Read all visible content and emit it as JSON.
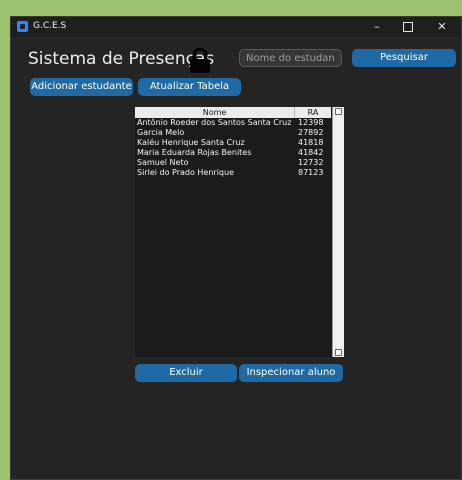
{
  "window": {
    "app_title": "G.C.E.S"
  },
  "icons": {
    "app": "app-logo-icon",
    "minimize": "minimize-icon",
    "maximize": "maximize-icon",
    "close": "close-icon",
    "lock": "lock-icon"
  },
  "header": {
    "title": "Sistema de Presenças",
    "search_placeholder": "Nome do estudante",
    "search_button": "Pesquisar"
  },
  "toolbar": {
    "add_student": "Adicionar estudante",
    "refresh_table": "Atualizar Tabela"
  },
  "table": {
    "columns": [
      "Nome",
      "RA"
    ],
    "rows": [
      {
        "name": "Antônio Roeder dos Santos Santa Cruz",
        "ra": "12398"
      },
      {
        "name": "Garcia Melo",
        "ra": "27892"
      },
      {
        "name": "Kaléu Henrique Santa Cruz",
        "ra": "41818"
      },
      {
        "name": "Maria Eduarda Rojas Benites",
        "ra": "41842"
      },
      {
        "name": "Samuel Neto",
        "ra": "12732"
      },
      {
        "name": "Sirlei do Prado Henrique",
        "ra": "87123"
      }
    ]
  },
  "actions": {
    "delete": "Excluir",
    "inspect": "Inspecionar aluno"
  },
  "colors": {
    "accent": "#1f6aa5",
    "background": "#242424",
    "outer": "#9bc36f"
  }
}
